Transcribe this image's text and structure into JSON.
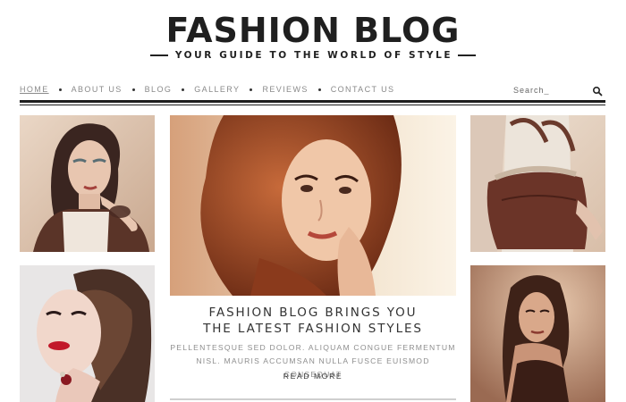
{
  "header": {
    "title": "FASHION BLOG",
    "tagline": "YOUR GUIDE TO THE WORLD OF STYLE"
  },
  "nav": {
    "items": [
      {
        "label": "HOME",
        "active": true
      },
      {
        "label": "ABOUT US",
        "active": false
      },
      {
        "label": "BLOG",
        "active": false
      },
      {
        "label": "GALLERY",
        "active": false
      },
      {
        "label": "REVIEWS",
        "active": false
      },
      {
        "label": "CONTACT US",
        "active": false
      }
    ]
  },
  "search": {
    "placeholder": "Search_",
    "icon": "search-icon"
  },
  "feature": {
    "title_line1": "FASHION BLOG BRINGS YOU",
    "title_line2": "THE LATEST FASHION STYLES",
    "excerpt_line1": "PELLENTESQUE SED DOLOR. ALIQUAM CONGUE FERMENTUM",
    "excerpt_line2": "NISL. MAURIS ACCUMSAN NULLA FUSCE EUISMOD CONSEQUAT",
    "read_more": "READ MORE"
  },
  "colors": {
    "text_dark": "#222222",
    "nav_text": "#8a8a8a",
    "excerpt_text": "#8e8e8e",
    "rule": "#1e1e1e"
  }
}
